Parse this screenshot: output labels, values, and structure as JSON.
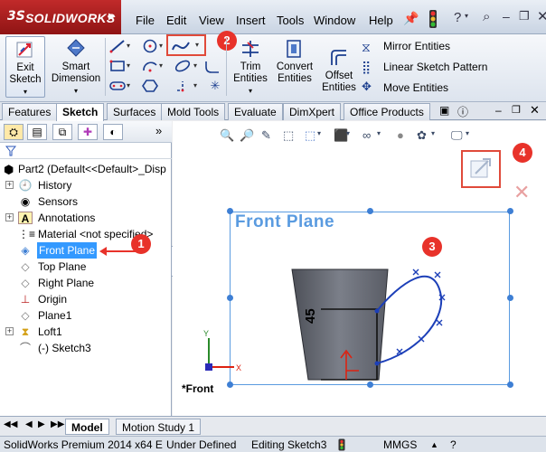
{
  "app": {
    "brand": "SOLIDWORKS",
    "logo_mark": "3S"
  },
  "menu": [
    "File",
    "Edit",
    "View",
    "Insert",
    "Tools",
    "Window",
    "Help"
  ],
  "title_icons": [
    "pin-icon",
    "traffic-light-icon",
    "help-icon",
    "search-icon",
    "minimize-icon",
    "restore-icon",
    "close-icon"
  ],
  "ribbon": {
    "exit_sketch": "Exit\nSketch",
    "exit_sketch_l1": "Exit",
    "exit_sketch_l2": "Sketch",
    "smart_dim_l1": "Smart",
    "smart_dim_l2": "Dimension",
    "trim_l1": "Trim",
    "trim_l2": "Entities",
    "convert_l1": "Convert",
    "convert_l2": "Entities",
    "offset_l1": "Offset",
    "offset_l2": "Entities",
    "mirror": "Mirror Entities",
    "linear_pattern": "Linear Sketch Pattern",
    "move": "Move Entities"
  },
  "tabs": [
    {
      "label": "Features",
      "active": false
    },
    {
      "label": "Sketch",
      "active": true
    },
    {
      "label": "Surfaces",
      "active": false
    },
    {
      "label": "Mold Tools",
      "active": false
    },
    {
      "label": "Evaluate",
      "active": false
    },
    {
      "label": "DimXpert",
      "active": false
    },
    {
      "label": "Office Products",
      "active": false
    }
  ],
  "tree": {
    "root": "Part2  (Default<<Default>_Disp",
    "items": [
      {
        "label": "History",
        "icon": "history-icon",
        "expand": true
      },
      {
        "label": "Sensors",
        "icon": "sensor-icon",
        "expand": false
      },
      {
        "label": "Annotations",
        "icon": "annotations-icon",
        "expand": true
      },
      {
        "label": "Material <not specified>",
        "icon": "material-icon",
        "expand": false
      },
      {
        "label": "Front Plane",
        "icon": "plane-icon",
        "expand": false,
        "selected": true
      },
      {
        "label": "Top Plane",
        "icon": "plane-icon",
        "expand": false
      },
      {
        "label": "Right Plane",
        "icon": "plane-icon",
        "expand": false
      },
      {
        "label": "Origin",
        "icon": "origin-icon",
        "expand": false
      },
      {
        "label": "Plane1",
        "icon": "plane-icon",
        "expand": false
      },
      {
        "label": "Loft1",
        "icon": "loft-icon",
        "expand": true
      },
      {
        "label": "(-) Sketch3",
        "icon": "sketch-icon",
        "expand": false
      }
    ]
  },
  "graphics": {
    "plane_label": "Front Plane",
    "dimension": "45",
    "view_label": "*Front"
  },
  "callouts": [
    "1",
    "2",
    "3",
    "4"
  ],
  "bottom_tabs": [
    {
      "label": "Model",
      "active": true
    },
    {
      "label": "Motion Study 1",
      "active": false
    }
  ],
  "status": {
    "product": "SolidWorks Premium 2014 x64 E",
    "state": "Under Defined",
    "editing": "Editing Sketch3",
    "units": "MMGS"
  },
  "colors": {
    "brand_red": "#c12a2a",
    "accent_blue": "#3e7fd4",
    "callout_red": "#e8322a",
    "selection": "#3399ff"
  }
}
